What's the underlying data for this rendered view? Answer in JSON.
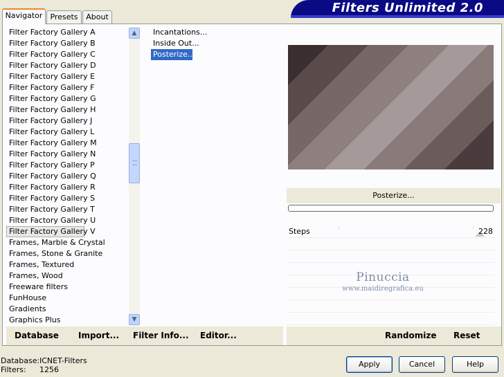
{
  "tabs": {
    "navigator": "Navigator",
    "presets": "Presets",
    "about": "About"
  },
  "app_title": "Filters Unlimited 2.0",
  "categories": [
    "Filter Factory Gallery A",
    "Filter Factory Gallery B",
    "Filter Factory Gallery C",
    "Filter Factory Gallery D",
    "Filter Factory Gallery E",
    "Filter Factory Gallery F",
    "Filter Factory Gallery G",
    "Filter Factory Gallery H",
    "Filter Factory Gallery J",
    "Filter Factory Gallery L",
    "Filter Factory Gallery M",
    "Filter Factory Gallery N",
    "Filter Factory Gallery P",
    "Filter Factory Gallery Q",
    "Filter Factory Gallery R",
    "Filter Factory Gallery S",
    "Filter Factory Gallery T",
    "Filter Factory Gallery U",
    "Filter Factory Gallery V",
    "Frames, Marble & Crystal",
    "Frames, Stone & Granite",
    "Frames, Textured",
    "Frames, Wood",
    "Freeware filters",
    "FunHouse",
    "Gradients",
    "Graphics Plus"
  ],
  "selected_category": "Filter Factory Gallery V",
  "filters": [
    "Incantations...",
    "Inside Out...",
    "Posterize..."
  ],
  "selected_filter": "Posterize...",
  "preview": {
    "filter_name": "Posterize...",
    "progress": 0
  },
  "controls": [
    {
      "label": "Steps",
      "value": "228"
    }
  ],
  "watermark": {
    "name": "Pinuccia",
    "url": "www.maidiregrafica.eu"
  },
  "bottom_buttons": {
    "database": "Database",
    "import": "Import...",
    "filter_info": "Filter Info...",
    "editor": "Editor...",
    "randomize": "Randomize",
    "reset": "Reset"
  },
  "status": {
    "database_label": "Database:",
    "database_value": "ICNET-Filters",
    "filters_label": "Filters:",
    "filters_value": "1256"
  },
  "dialog_buttons": {
    "apply": "Apply",
    "cancel": "Cancel",
    "help": "Help"
  },
  "colors": {
    "accent": "#316ac5",
    "title_bar": "#0a0a84",
    "tab_highlight": "#e68b2c",
    "preview_bands": [
      "#3a2e2e",
      "#5a4b4b",
      "#776767",
      "#8f8080",
      "#a69999",
      "#8a7b7b",
      "#6b5c5c",
      "#4a3c3c"
    ]
  }
}
